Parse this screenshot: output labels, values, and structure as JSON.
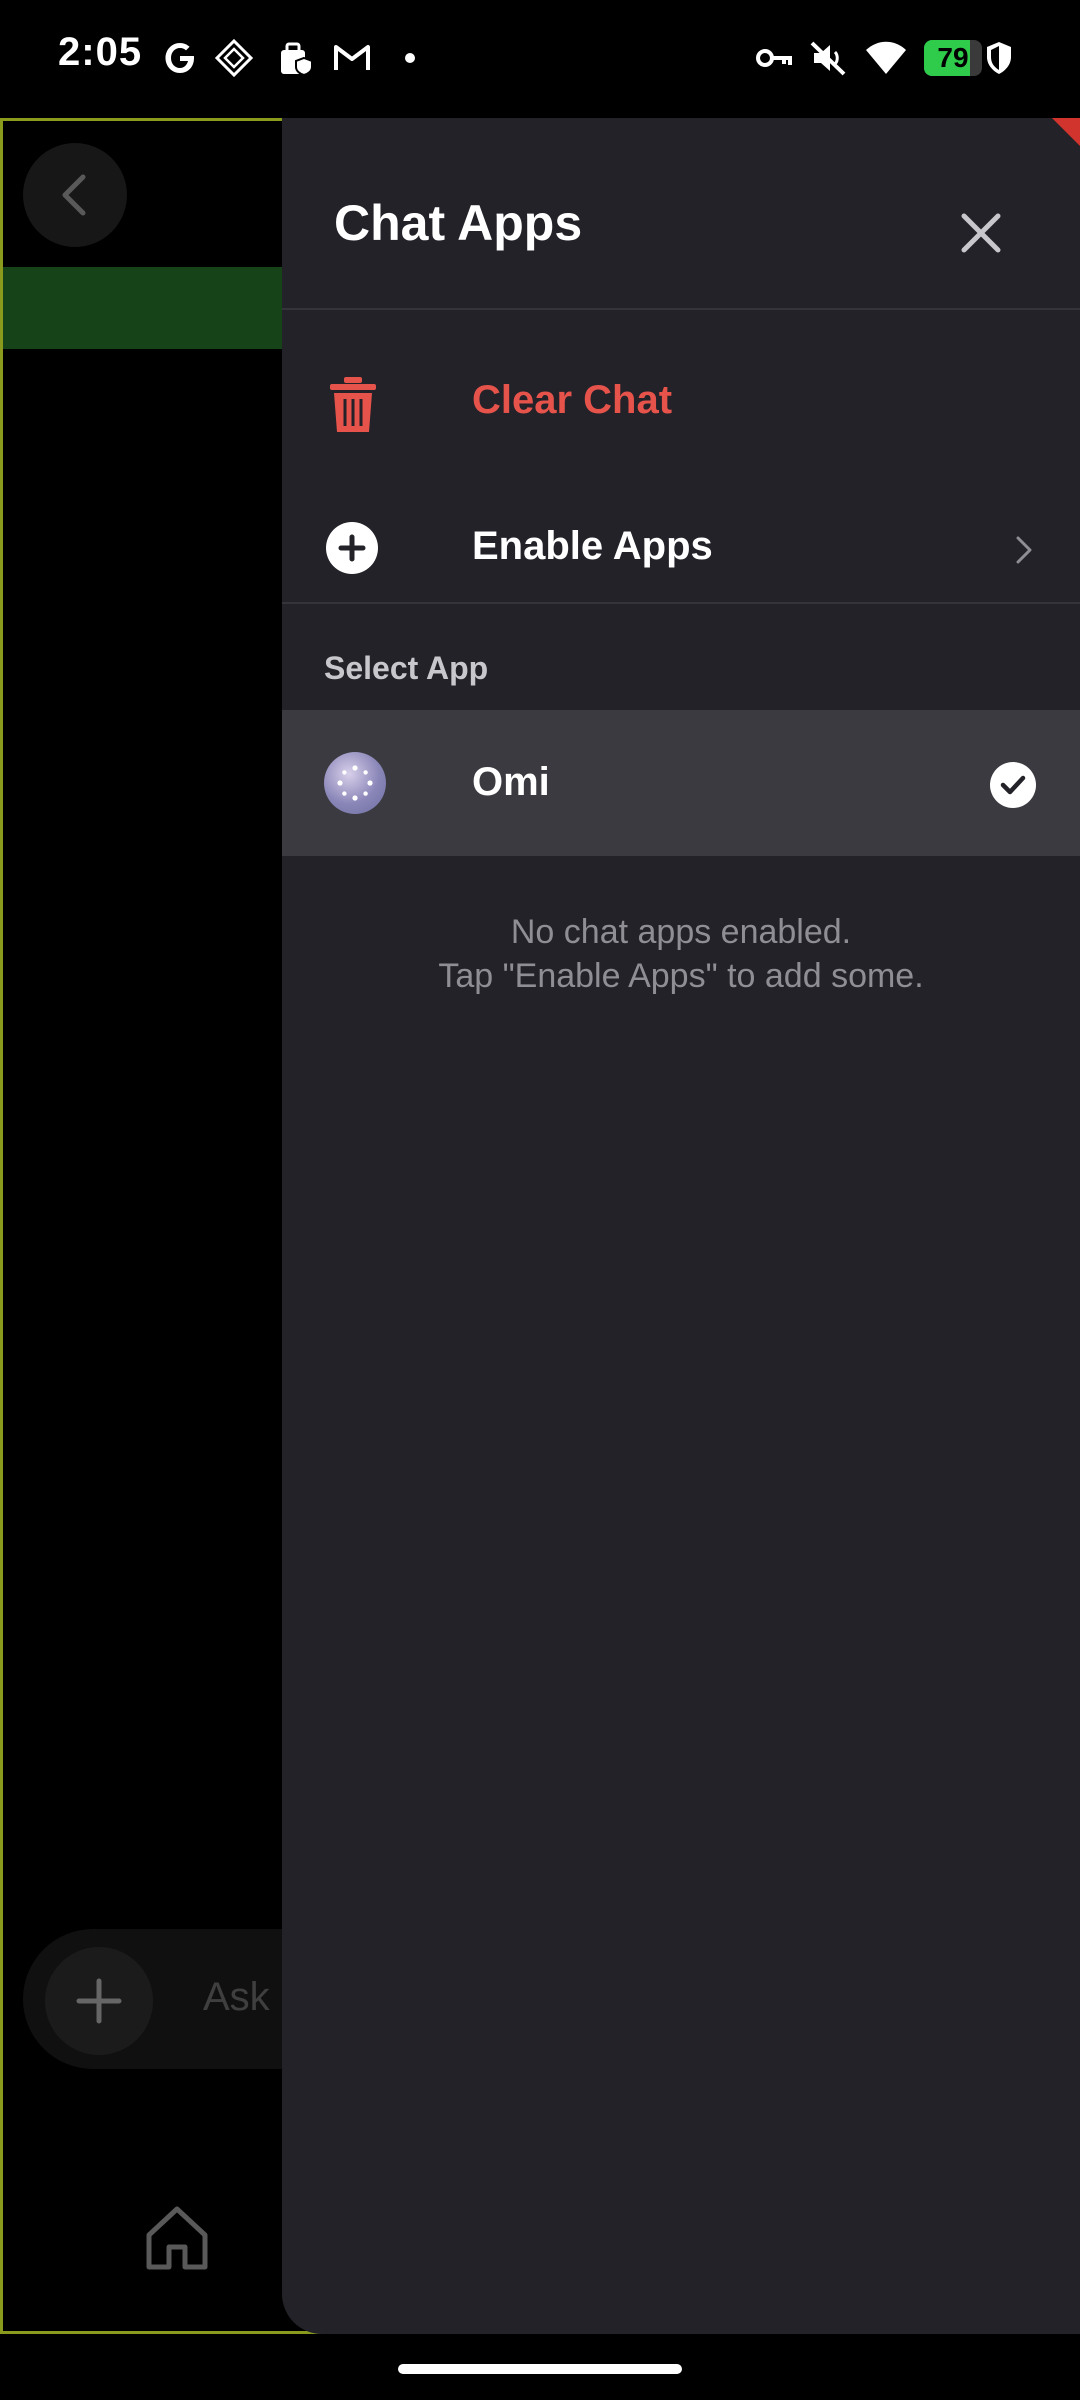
{
  "status_bar": {
    "time": "2:05",
    "battery": "79",
    "battery_level_percent": 79,
    "icons": [
      "google-icon",
      "diamond-app-icon",
      "work-profile-icon",
      "gmail-icon",
      "notification-dot-icon",
      "vpn-key-icon",
      "mute-icon",
      "wifi-icon",
      "battery-icon",
      "shield-icon"
    ]
  },
  "background": {
    "input_placeholder": "Ask",
    "accent_green": "#1f5a22"
  },
  "drawer": {
    "title": "Chat Apps",
    "clear_chat_label": "Clear Chat",
    "enable_apps_label": "Enable Apps",
    "section_label": "Select App",
    "selected_app": "Omi",
    "empty_line1": "No chat apps enabled.",
    "empty_line2": "Tap \"Enable Apps\" to add some.",
    "danger_color": "#e5534b"
  }
}
